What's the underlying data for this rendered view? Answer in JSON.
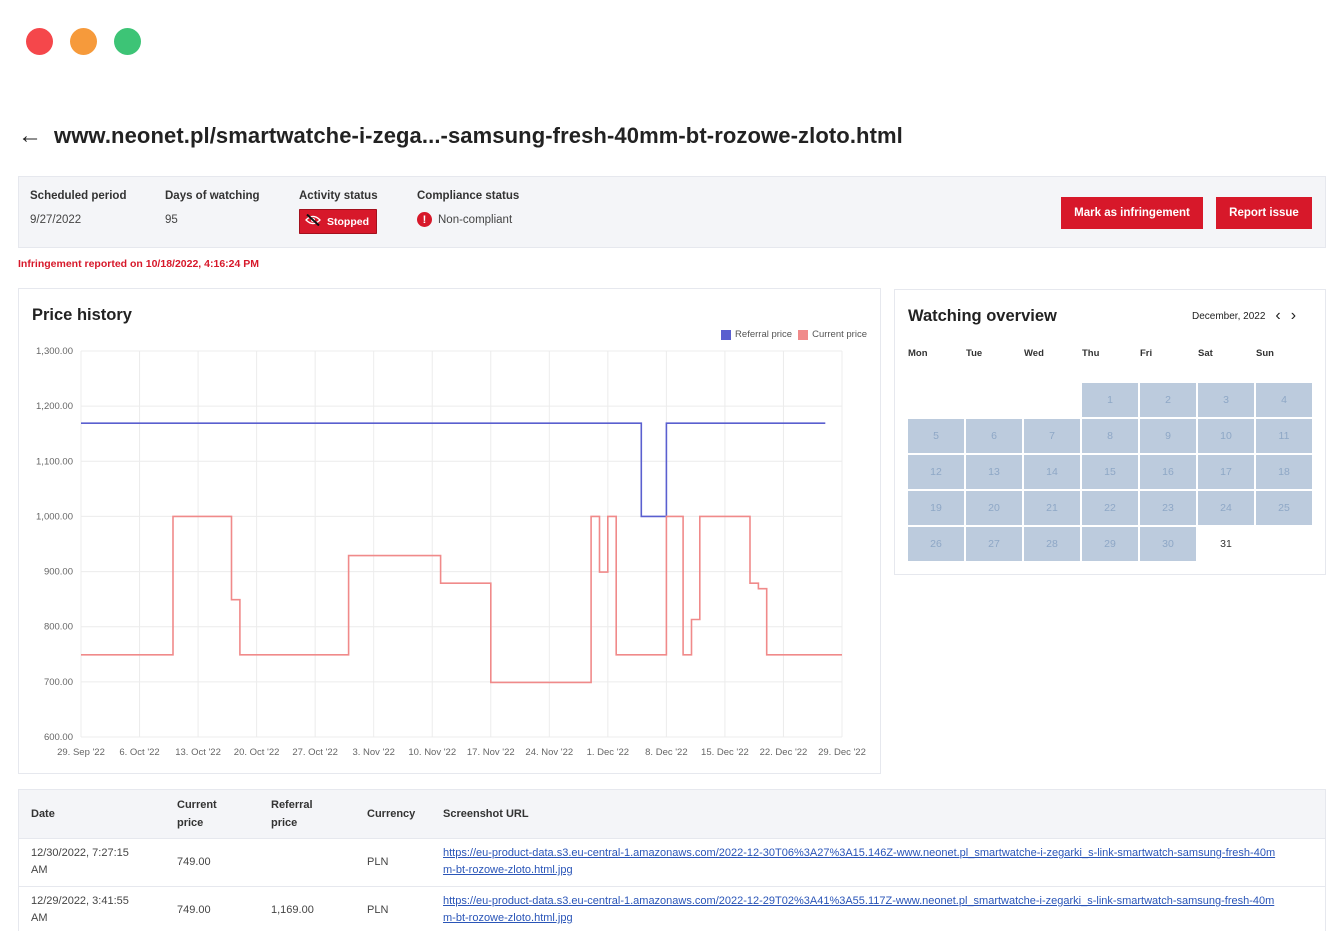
{
  "window": {
    "controls": [
      {
        "name": "close",
        "color": "#f5474b"
      },
      {
        "name": "minimize",
        "color": "#f69a3b"
      },
      {
        "name": "maximize",
        "color": "#3dc476"
      }
    ]
  },
  "header": {
    "back_icon": "arrow-left-icon",
    "back_glyph": "←",
    "title": "www.neonet.pl/smartwatche-i-zega...-samsung-fresh-40mm-bt-rozowe-zloto.html"
  },
  "info": {
    "scheduled_period": {
      "label": "Scheduled period",
      "value": "9/27/2022"
    },
    "days_watching": {
      "label": "Days of watching",
      "value": "95"
    },
    "activity_status": {
      "label": "Activity status",
      "value": "Stopped",
      "icon": "eye-off-icon"
    },
    "compliance_status": {
      "label": "Compliance status",
      "value": "Non-compliant",
      "icon": "alert-icon",
      "icon_glyph": "!"
    },
    "buttons": {
      "mark": "Mark as infringement",
      "report": "Report issue"
    },
    "accent_color": "#d7182a"
  },
  "infringement_note": "Infringement reported on 10/18/2022, 4:16:24 PM",
  "price_history": {
    "title": "Price history",
    "legend": {
      "referral": "Referral price",
      "current": "Current price"
    }
  },
  "chart_data": {
    "type": "line",
    "title": "Price history",
    "x_tick_labels": [
      "29. Sep '22",
      "6. Oct '22",
      "13. Oct '22",
      "20. Oct '22",
      "27. Oct '22",
      "3. Nov '22",
      "10. Nov '22",
      "17. Nov '22",
      "24. Nov '22",
      "1. Dec '22",
      "8. Dec '22",
      "15. Dec '22",
      "22. Dec '22",
      "29. Dec '22"
    ],
    "y_tick_labels": [
      "600.00",
      "700.00",
      "800.00",
      "900.00",
      "1,000.00",
      "1,100.00",
      "1,200.00",
      "1,300.00"
    ],
    "x_range": [
      "2022-09-29",
      "2022-12-29"
    ],
    "ylim": [
      600,
      1300
    ],
    "grid": true,
    "legend_position": "top-right",
    "series": [
      {
        "name": "Referral price",
        "color": "#5a5fcf",
        "step": true,
        "points": [
          [
            "2022-09-29",
            1169
          ],
          [
            "2022-12-05",
            1169
          ],
          [
            "2022-12-05",
            1000
          ],
          [
            "2022-12-08",
            1000
          ],
          [
            "2022-12-08",
            1169
          ],
          [
            "2022-12-27",
            1169
          ]
        ]
      },
      {
        "name": "Current price",
        "color": "#f08a8a",
        "step": true,
        "points": [
          [
            "2022-09-29",
            749
          ],
          [
            "2022-10-10",
            749
          ],
          [
            "2022-10-10",
            1000
          ],
          [
            "2022-10-17",
            1000
          ],
          [
            "2022-10-17",
            849
          ],
          [
            "2022-10-18",
            849
          ],
          [
            "2022-10-18",
            749
          ],
          [
            "2022-10-31",
            749
          ],
          [
            "2022-10-31",
            929
          ],
          [
            "2022-11-11",
            929
          ],
          [
            "2022-11-11",
            879
          ],
          [
            "2022-11-17",
            879
          ],
          [
            "2022-11-17",
            699
          ],
          [
            "2022-11-29",
            699
          ],
          [
            "2022-11-29",
            1000
          ],
          [
            "2022-11-30",
            1000
          ],
          [
            "2022-11-30",
            899
          ],
          [
            "2022-12-01",
            899
          ],
          [
            "2022-12-01",
            1000
          ],
          [
            "2022-12-02",
            1000
          ],
          [
            "2022-12-02",
            749
          ],
          [
            "2022-12-08",
            749
          ],
          [
            "2022-12-08",
            1000
          ],
          [
            "2022-12-10",
            1000
          ],
          [
            "2022-12-10",
            749
          ],
          [
            "2022-12-11",
            749
          ],
          [
            "2022-12-11",
            813
          ],
          [
            "2022-12-12",
            813
          ],
          [
            "2022-12-12",
            1000
          ],
          [
            "2022-12-18",
            1000
          ],
          [
            "2022-12-18",
            879
          ],
          [
            "2022-12-19",
            879
          ],
          [
            "2022-12-19",
            869
          ],
          [
            "2022-12-20",
            869
          ],
          [
            "2022-12-20",
            749
          ],
          [
            "2022-12-29",
            749
          ]
        ]
      }
    ]
  },
  "calendar": {
    "title": "Watching overview",
    "month": "December, 2022",
    "prev_icon": "chevron-left-icon",
    "prev_glyph": "‹",
    "next_icon": "chevron-right-icon",
    "next_glyph": "›",
    "weekdays": [
      "Mon",
      "Tue",
      "Wed",
      "Thu",
      "Fri",
      "Sat",
      "Sun"
    ],
    "first_weekday_index": 3,
    "days": 31,
    "watched_through": 30,
    "watched_color": "#bccbdd"
  },
  "table": {
    "headers": {
      "date": "Date",
      "current_1": "Current",
      "current_2": "price",
      "referral_1": "Referral",
      "referral_2": "price",
      "currency": "Currency",
      "url": "Screenshot URL"
    },
    "rows": [
      {
        "date_1": "12/30/2022, 7:27:15",
        "date_2": "AM",
        "current": "749.00",
        "referral": "",
        "currency": "PLN",
        "url_1": "https://eu-product-data.s3.eu-central-1.amazonaws.com/2022-12-30T06%3A27%3A15.146Z-www.neonet.pl_smartwatche-i-zegarki_s-link-smartwatch-samsung-fresh-40m",
        "url_2": "m-bt-rozowe-zloto.html.jpg"
      },
      {
        "date_1": "12/29/2022, 3:41:55",
        "date_2": "AM",
        "current": "749.00",
        "referral": "1,169.00",
        "currency": "PLN",
        "url_1": "https://eu-product-data.s3.eu-central-1.amazonaws.com/2022-12-29T02%3A41%3A55.117Z-www.neonet.pl_smartwatche-i-zegarki_s-link-smartwatch-samsung-fresh-40m",
        "url_2": "m-bt-rozowe-zloto.html.jpg"
      }
    ]
  }
}
